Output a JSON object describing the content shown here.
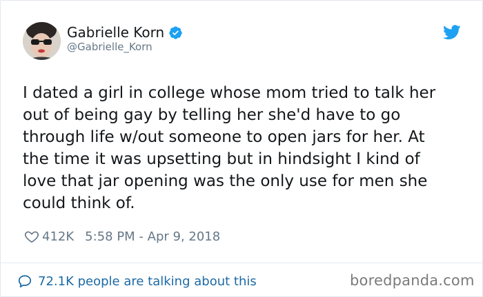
{
  "user": {
    "display_name": "Gabrielle Korn",
    "handle": "@Gabrielle_Korn",
    "verified": true
  },
  "tweet": {
    "lines": [
      "I dated a girl in college whose mom tried to talk her",
      "out of being gay by telling her she'd have to go",
      "through life w/out someone to open jars for her. At",
      "the time it was upsetting but in hindsight I kind of",
      "love that jar opening was the only use for men she",
      "could think of."
    ],
    "likes": "412K",
    "timestamp": "5:58 PM - Apr 9, 2018"
  },
  "footer": {
    "talking_text": "72.1K people are talking about this",
    "watermark": "boredpanda.com"
  },
  "icons": {
    "verified": "verified-badge-icon",
    "twitter": "twitter-bird-icon",
    "heart": "heart-icon",
    "comment": "speech-bubble-icon"
  },
  "colors": {
    "twitter_blue": "#1da1f2",
    "link_blue": "#1b6aa5",
    "meta_gray": "#657786"
  }
}
